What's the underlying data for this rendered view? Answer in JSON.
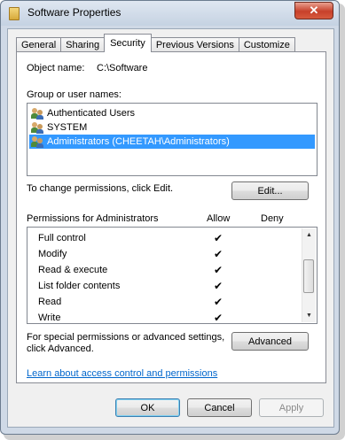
{
  "window": {
    "title": "Software Properties",
    "close_glyph": "✕",
    "title_icon": "folder-icon"
  },
  "tabs": [
    {
      "label": "General",
      "active": false
    },
    {
      "label": "Sharing",
      "active": false
    },
    {
      "label": "Security",
      "active": true
    },
    {
      "label": "Previous Versions",
      "active": false
    },
    {
      "label": "Customize",
      "active": false
    }
  ],
  "security": {
    "object_name_label": "Object name:",
    "object_name_value": "C:\\Software",
    "group_label": "Group or user names:",
    "groups": [
      {
        "name": "Authenticated Users",
        "icon": "users-icon",
        "selected": false
      },
      {
        "name": "SYSTEM",
        "icon": "users-icon",
        "selected": false
      },
      {
        "name": "Administrators (CHEETAH\\Administrators)",
        "icon": "users-icon",
        "selected": true
      }
    ],
    "change_text": "To change permissions, click Edit.",
    "edit_button": "Edit...",
    "permissions_label": "Permissions for Administrators",
    "allow_header": "Allow",
    "deny_header": "Deny",
    "permissions": [
      {
        "name": "Full control",
        "allow": true,
        "deny": false
      },
      {
        "name": "Modify",
        "allow": true,
        "deny": false
      },
      {
        "name": "Read & execute",
        "allow": true,
        "deny": false
      },
      {
        "name": "List folder contents",
        "allow": true,
        "deny": false
      },
      {
        "name": "Read",
        "allow": true,
        "deny": false
      },
      {
        "name": "Write",
        "allow": true,
        "deny": false
      }
    ],
    "check_glyph": "✔",
    "special_text_line1": "For special permissions or advanced settings,",
    "special_text_line2": "click Advanced.",
    "advanced_button": "Advanced",
    "learn_link": "Learn about access control and permissions"
  },
  "footer": {
    "ok": "OK",
    "cancel": "Cancel",
    "apply": "Apply"
  },
  "colors": {
    "selection": "#3399ff",
    "link": "#0066cc",
    "frame": "#cfd9e6"
  }
}
